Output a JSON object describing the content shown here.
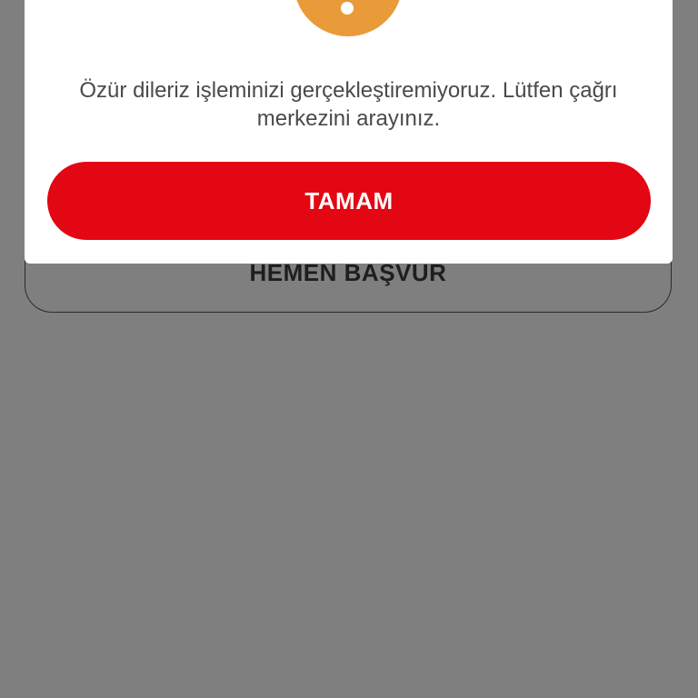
{
  "background_button": {
    "label": "HEMEN BAŞVUR"
  },
  "dialog": {
    "icon": "warning-icon",
    "message": "Özür dileriz işleminizi gerçekleştiremiyoruz. Lütfen çağrı merkezini arayınız.",
    "ok_label": "TAMAM"
  },
  "colors": {
    "overlay": "#7f7f7f",
    "primary": "#e30613",
    "warning": "#e99b3a",
    "text": "#4a4a4a"
  }
}
